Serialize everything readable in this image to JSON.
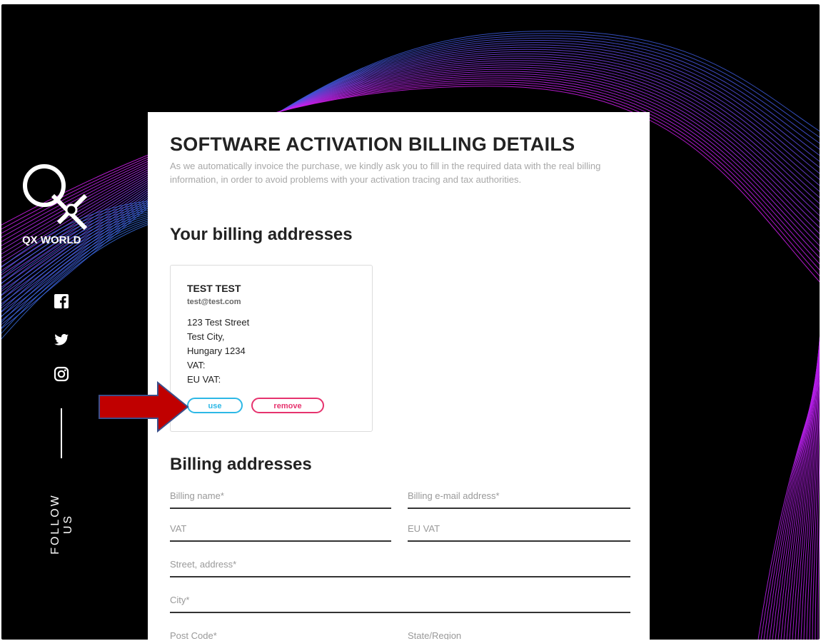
{
  "brand": {
    "name": "QX WORLD"
  },
  "social": {
    "icons": [
      "facebook-icon",
      "twitter-icon",
      "instagram-icon"
    ],
    "follow_label": "FOLLOW US"
  },
  "page": {
    "title": "SOFTWARE ACTIVATION BILLING DETAILS",
    "intro": "As we automatically invoice the purchase, we kindly ask you to fill in the required data with the real billing information, in order to avoid problems with your activation tracing and tax authorities."
  },
  "saved_addresses": {
    "heading": "Your billing addresses",
    "items": [
      {
        "name": "TEST TEST",
        "email": "test@test.com",
        "street": "123 Test Street",
        "city": "Test City,",
        "country": "Hungary 1234",
        "vat": "VAT:",
        "eu_vat": "EU VAT:",
        "use_label": "use",
        "remove_label": "remove"
      }
    ]
  },
  "form": {
    "heading": "Billing addresses",
    "fields": {
      "billing_name": "Billing name*",
      "billing_email": "Billing e-mail address*",
      "vat": "VAT",
      "eu_vat": "EU VAT",
      "street": "Street, address*",
      "city": "City*",
      "post_code": "Post Code*",
      "state": "State/Region"
    }
  },
  "colors": {
    "use_button": "#2db8e6",
    "remove_button": "#e6336e",
    "arrow": "#c00000"
  }
}
